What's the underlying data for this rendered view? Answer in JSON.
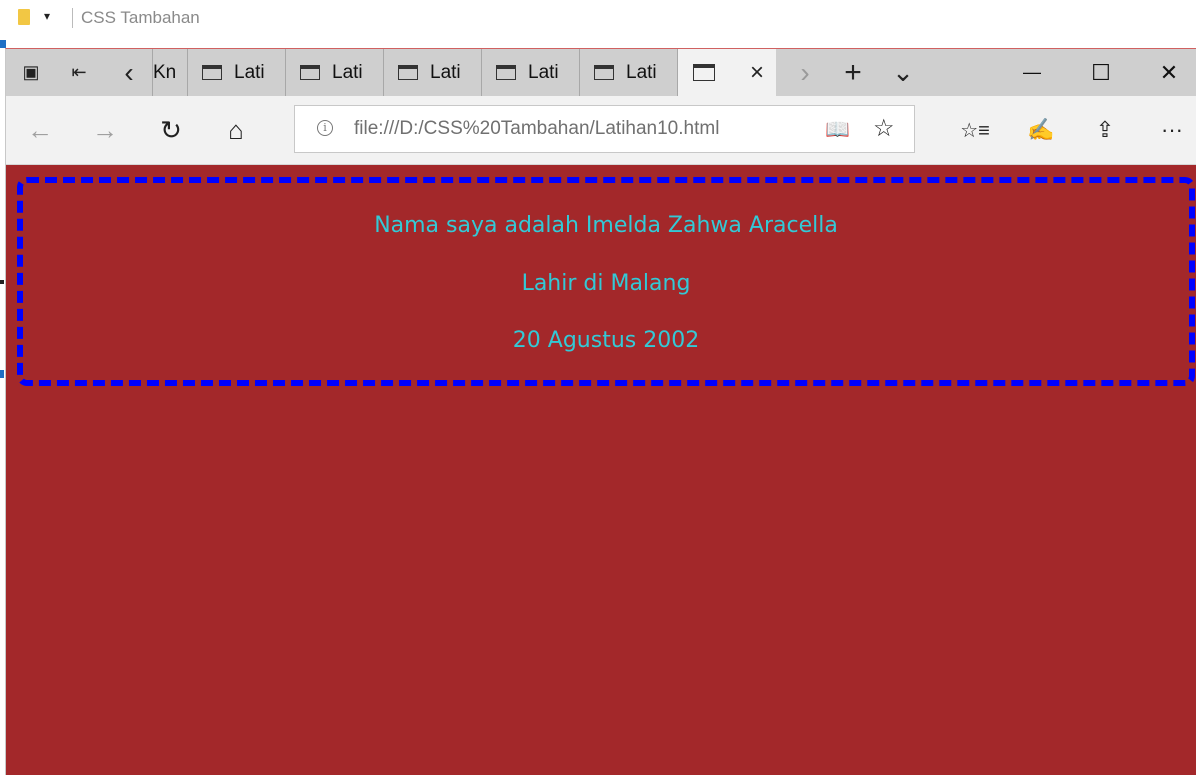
{
  "explorer": {
    "title": "CSS Tambahan",
    "dropdown_glyph": "▾"
  },
  "browser": {
    "tabs": [
      {
        "label": "Kn"
      },
      {
        "label": "Lati"
      },
      {
        "label": "Lati"
      },
      {
        "label": "Lati"
      },
      {
        "label": "Lati"
      },
      {
        "label": "Lati"
      },
      {
        "label": ""
      }
    ],
    "address": {
      "url": "file:///D:/CSS%20Tambahan/Latihan10.html"
    },
    "icons": {
      "tab_manager": "▣",
      "set_aside": "⇤",
      "scroll_left": "‹",
      "scroll_right": "›",
      "new_tab": "+",
      "tab_preview": "⌄",
      "close_tab": "×",
      "minimize": "—",
      "maximize": "☐",
      "close_window": "✕",
      "back": "←",
      "forward": "→",
      "refresh": "↻",
      "home": "⌂",
      "info": "i",
      "reading_view": "📖",
      "favorite": "☆",
      "favorites_hub": "☆≡",
      "notes": "✍",
      "share": "⇪",
      "more": "···"
    }
  },
  "page": {
    "lines": [
      "Nama saya adalah Imelda Zahwa Aracella",
      "Lahir di Malang",
      "20 Agustus 2002"
    ],
    "colors": {
      "background": "#a3282a",
      "text": "#33c9d6",
      "border": "#0000ff"
    }
  }
}
